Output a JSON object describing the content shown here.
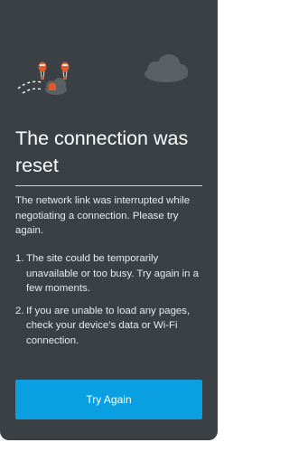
{
  "error": {
    "title": "The connection was reset",
    "description": "The network link was interrupted while negotiating a connection. Please try again.",
    "reasons": [
      {
        "number": "1.",
        "text": "The site could be temporarily unavailable or too busy. Try again in a few moments."
      },
      {
        "number": "2.",
        "text": "If you are unable to load any pages, check your device’s data or Wi-Fi connection."
      }
    ]
  },
  "actions": {
    "try_again_label": "Try Again"
  },
  "illustration": {
    "icons": [
      "balloon-icon",
      "cloud-icon",
      "dashed-flight-path"
    ]
  },
  "colors": {
    "background": "#3b4044",
    "accent": "#0a9fe0",
    "balloon": "#e25a2b",
    "cloud": "#5b6064"
  }
}
